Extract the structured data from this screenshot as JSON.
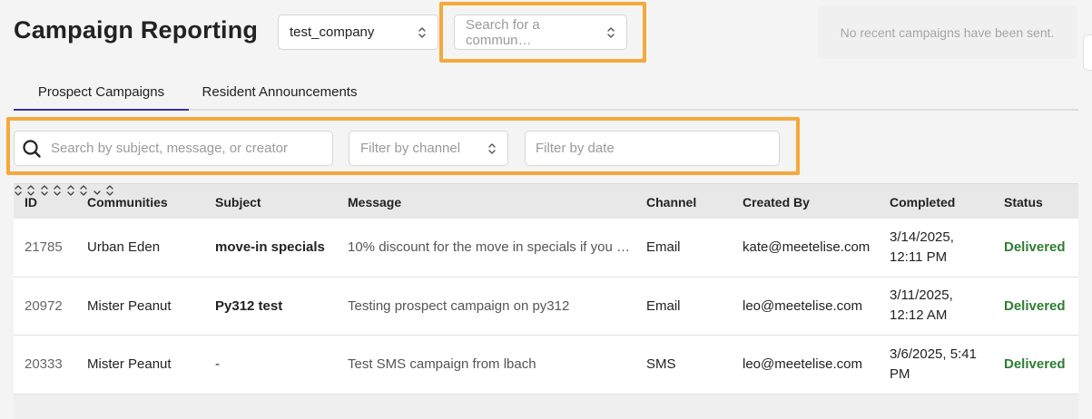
{
  "header": {
    "title": "Campaign Reporting",
    "company_select": "test_company",
    "community_placeholder": "Search for a commun…",
    "notice": "No recent campaigns have been sent."
  },
  "tabs": [
    {
      "label": "Prospect Campaigns",
      "active": true
    },
    {
      "label": "Resident Announcements",
      "active": false
    }
  ],
  "filters": {
    "search_placeholder": "Search by subject, message, or creator",
    "channel_placeholder": "Filter by channel",
    "date_placeholder": "Filter by date"
  },
  "table": {
    "columns": [
      "ID",
      "Communities",
      "Subject",
      "Message",
      "Channel",
      "Created By",
      "Completed",
      "Status"
    ],
    "rows": [
      {
        "id": "21785",
        "community": "Urban Eden",
        "subject": "move-in specials",
        "message": "10% discount for the move in specials if you …",
        "channel": "Email",
        "created_by": "kate@meetelise.com",
        "completed": "3/14/2025, 12:11 PM",
        "status": "Delivered"
      },
      {
        "id": "20972",
        "community": "Mister Peanut",
        "subject": "Py312 test",
        "message": "Testing prospect campaign on py312",
        "channel": "Email",
        "created_by": "leo@meetelise.com",
        "completed": "3/11/2025, 12:12 AM",
        "status": "Delivered"
      },
      {
        "id": "20333",
        "community": "Mister Peanut",
        "subject": "-",
        "message": "Test SMS campaign from lbach",
        "channel": "SMS",
        "created_by": "leo@meetelise.com",
        "completed": "3/6/2025, 5:41 PM",
        "status": "Delivered"
      }
    ]
  },
  "colors": {
    "highlight": "#f5a93a",
    "active_tab": "#3b2f9c",
    "delivered": "#2e7d32"
  },
  "icons": [
    "chevron-up-down-icon",
    "search-icon",
    "sort-icon",
    "sort-desc-icon"
  ]
}
